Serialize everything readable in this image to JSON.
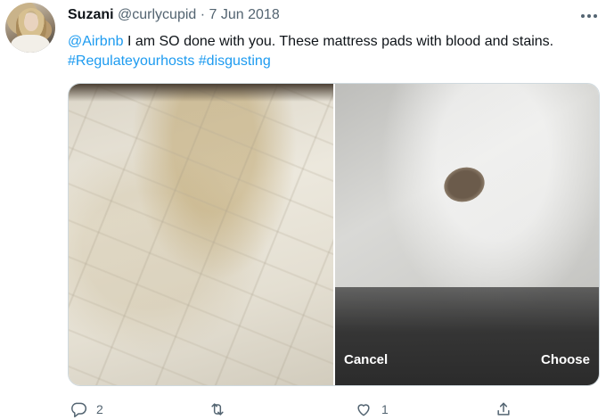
{
  "tweet": {
    "author_name": "Suzani",
    "handle": "@curlycupid",
    "separator": "·",
    "date": "7 Jun 2018",
    "text_mention": "@Airbnb",
    "text_body": " I am SO done with you.  These mattress pads with blood and stains. ",
    "hashtag_1": "#Regulateyourhosts",
    "hashtag_2": "#disgusting",
    "more_icon": "more-icon"
  },
  "media": {
    "cancel_label": "Cancel",
    "choose_label": "Choose"
  },
  "actions": {
    "reply_count": "2",
    "retweet_count": "",
    "like_count": "1",
    "icons": [
      "reply-icon",
      "retweet-icon",
      "like-icon",
      "share-icon"
    ]
  },
  "colors": {
    "link": "#1d9bf0",
    "secondary_text": "#536471",
    "primary_text": "#0f1419"
  }
}
